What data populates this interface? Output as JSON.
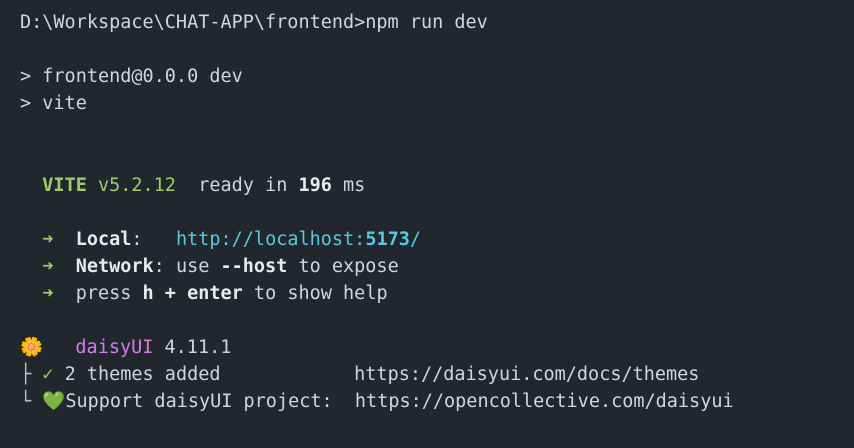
{
  "terminal": {
    "prompt_line": "D:\\Workspace\\CHAT-APP\\frontend>npm run dev",
    "script_line_1": "> frontend@0.0.0 dev",
    "script_line_2": "> vite"
  },
  "vite": {
    "name": "VITE",
    "version": "v5.2.12",
    "ready_text": "ready in",
    "ready_ms": "196",
    "ms_unit": "ms",
    "arrow": "➜",
    "local_label": "Local",
    "local_url_prefix": "http://localhost:",
    "local_port": "5173",
    "local_url_suffix": "/",
    "network_label": "Network",
    "network_text_1": ": use ",
    "network_flag": "--host",
    "network_text_2": " to expose",
    "help_text_1": "press ",
    "help_key_1": "h",
    "help_plus": " + ",
    "help_key_2": "enter",
    "help_text_2": " to show help"
  },
  "daisyui": {
    "flower_icon": "🌼",
    "name": "daisyUI",
    "version": "4.11.1",
    "tree_branch": "├",
    "tree_end": "└",
    "check_icon": "✓",
    "themes_text": "2 themes added",
    "themes_url": "https://daisyui.com/docs/themes",
    "heart_icon": "💚",
    "support_text": "Support daisyUI project:",
    "support_url": "https://opencollective.com/daisyui"
  },
  "colors": {
    "background": "#22272e",
    "text": "#cfd6de",
    "green": "#9ece6a",
    "cyan": "#56c8e6",
    "magenta": "#d27ee6"
  }
}
